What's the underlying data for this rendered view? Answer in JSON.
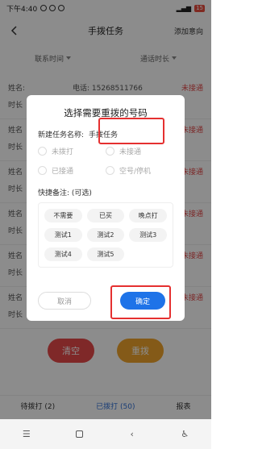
{
  "status_bar": {
    "time": "下午4:40",
    "battery": "15"
  },
  "header": {
    "title": "手拨任务",
    "action": "添加意向"
  },
  "filters": {
    "left": "联系时间",
    "right": "通话时长"
  },
  "list": {
    "row1": {
      "name": "姓名:",
      "phone": "电话: 15268511766",
      "state": "未接通",
      "duration": "时长"
    },
    "row2": {
      "name": "姓名",
      "state": "未接通",
      "duration": "时长"
    },
    "row3": {
      "name": "姓名",
      "state": "未接通",
      "duration": "时长"
    },
    "row4": {
      "name": "姓名",
      "state": "未接通",
      "duration": "时长"
    },
    "row5": {
      "name": "姓名",
      "state": "未接通",
      "duration": "时长"
    },
    "row6": {
      "name": "姓名",
      "state": "未接通",
      "duration": "时长"
    }
  },
  "buttons": {
    "clear": "清空",
    "redial": "重拨"
  },
  "tabs": {
    "pending": "待拨打 (2)",
    "dialed": "已拨打 (50)",
    "report": "报表"
  },
  "dialog": {
    "title": "选择需要重拨的号码",
    "task_label": "新建任务名称:",
    "task_value": "手拨任务",
    "options": [
      "未拨打",
      "未接通",
      "已接通",
      "空号/停机"
    ],
    "notes_label": "快捷备注: (可选)",
    "tags": [
      "不需要",
      "已买",
      "晚点打",
      "测试1",
      "测试2",
      "测试3",
      "测试4",
      "测试5"
    ],
    "cancel": "取消",
    "confirm": "确定"
  },
  "colors": {
    "accent": "#1e73e8",
    "danger": "#e84a4a",
    "warning": "#f0a52c",
    "highlight": "#e53030"
  }
}
